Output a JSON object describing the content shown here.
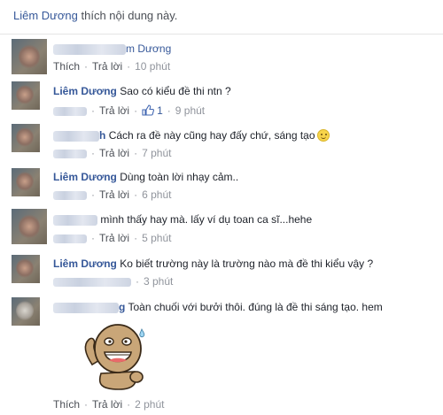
{
  "header": {
    "liker": "Liêm Dương",
    "text": " thích nội dung này."
  },
  "actions": {
    "like": "Thích",
    "reply": "Trả lời"
  },
  "comments": [
    {
      "author_visible": "m Dương",
      "text": "",
      "time": "10 phút",
      "show_like": true
    },
    {
      "author_visible": "Liêm Dương",
      "text": "Sao có kiểu đề thi ntn ?",
      "time": "9 phút",
      "likes": "1",
      "show_like": false
    },
    {
      "author_visible": "h",
      "text": "Cách ra đề này cũng hay đấy chứ, sáng tạo",
      "time": "7 phút",
      "show_like": false
    },
    {
      "author_visible": "Liêm Dương",
      "text": "Dùng toàn lời nhạy cảm..",
      "time": "6 phút",
      "show_like": false
    },
    {
      "author_visible": "",
      "text": "mình thấy hay mà. lấy ví dụ toan ca sĩ...hehe",
      "time": "5 phút",
      "show_like": false
    },
    {
      "author_visible": "Liêm Dương",
      "text": "Ko biết trường này là trường nào mà đề thi kiểu vậy ?",
      "time": "3 phút",
      "show_like": false
    },
    {
      "author_visible": "g",
      "text": "Toàn chuối với bưởi thôi. đúng là đề thi sáng tạo. hem",
      "time": "2 phút",
      "show_like": true
    }
  ],
  "colors": {
    "link": "#365899",
    "meta": "#90949c",
    "text": "#1d2129"
  }
}
